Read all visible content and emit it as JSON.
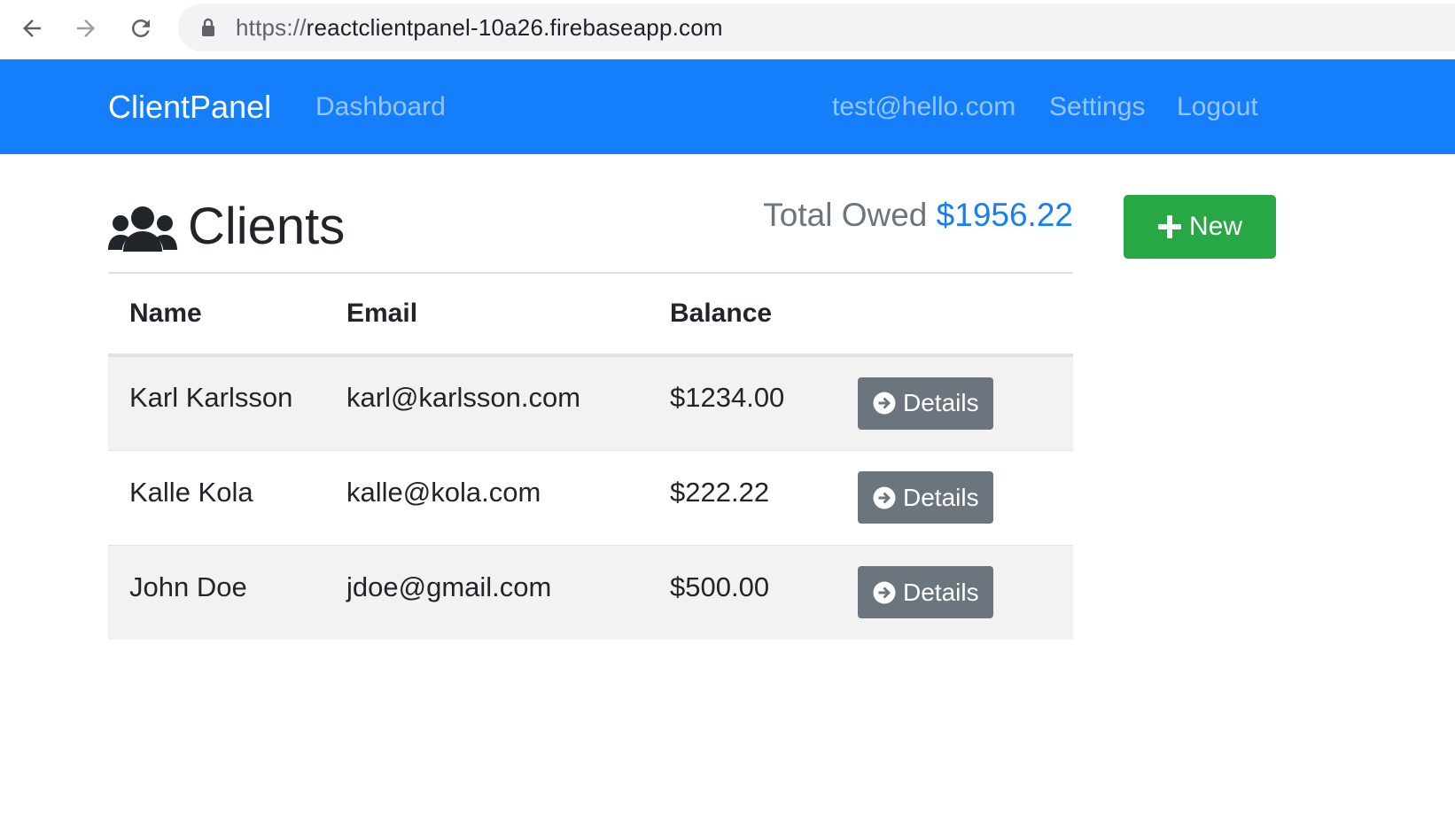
{
  "browser": {
    "url_scheme": "https://",
    "url_host": "reactclientpanel-10a26.firebaseapp.com"
  },
  "navbar": {
    "brand": "ClientPanel",
    "dashboard": "Dashboard",
    "user_email": "test@hello.com",
    "settings": "Settings",
    "logout": "Logout",
    "color": "#157ffb"
  },
  "page": {
    "title": "Clients",
    "total_label": "Total Owed",
    "total_amount": "$1956.22",
    "new_button": "New"
  },
  "table": {
    "headers": [
      "Name",
      "Email",
      "Balance"
    ],
    "rows": [
      {
        "name": "Karl Karlsson",
        "email": "karl@karlsson.com",
        "balance": "$1234.00",
        "action": "Details"
      },
      {
        "name": "Kalle Kola",
        "email": "kalle@kola.com",
        "balance": "$222.22",
        "action": "Details"
      },
      {
        "name": "John Doe",
        "email": "jdoe@gmail.com",
        "balance": "$500.00",
        "action": "Details"
      }
    ]
  },
  "icons": {
    "back": "arrow-left-icon",
    "forward": "arrow-right-icon",
    "reload": "reload-icon",
    "lock": "lock-icon",
    "users": "users-icon",
    "plus": "plus-icon",
    "details": "arrow-circle-right-icon"
  }
}
